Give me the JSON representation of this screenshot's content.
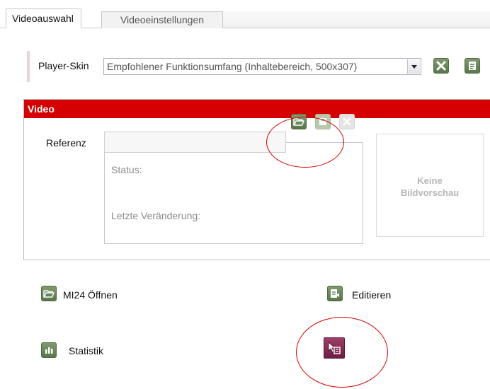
{
  "tabs": [
    {
      "label": "Videoauswahl",
      "active": true
    },
    {
      "label": "Videoeinstellungen",
      "active": false
    }
  ],
  "player_skin": {
    "label": "Player-Skin",
    "selected": "Empfohlener Funktionsumfang (Inhaltebereich, 500x307)"
  },
  "video_panel": {
    "title": "Video",
    "reference_label": "Referenz",
    "reference_value": "",
    "status_label": "Status:",
    "last_change_label": "Letzte Veränderung:",
    "preview_text_line1": "Keine",
    "preview_text_line2": "Bildvorschau"
  },
  "actions": {
    "open_label": "MI24 Öffnen",
    "edit_label": "Editieren",
    "stats_label": "Statistik"
  },
  "colors": {
    "header_red": "#d70000",
    "button_green": "#6b8a5c",
    "edit_purple": "#8b2a55",
    "annotation_red": "#d40000"
  },
  "icons": [
    "close-icon",
    "document-icon",
    "folder-open-icon",
    "save-icon",
    "delete-icon",
    "edit-icon",
    "statistics-icon",
    "pointer-edit-icon"
  ]
}
